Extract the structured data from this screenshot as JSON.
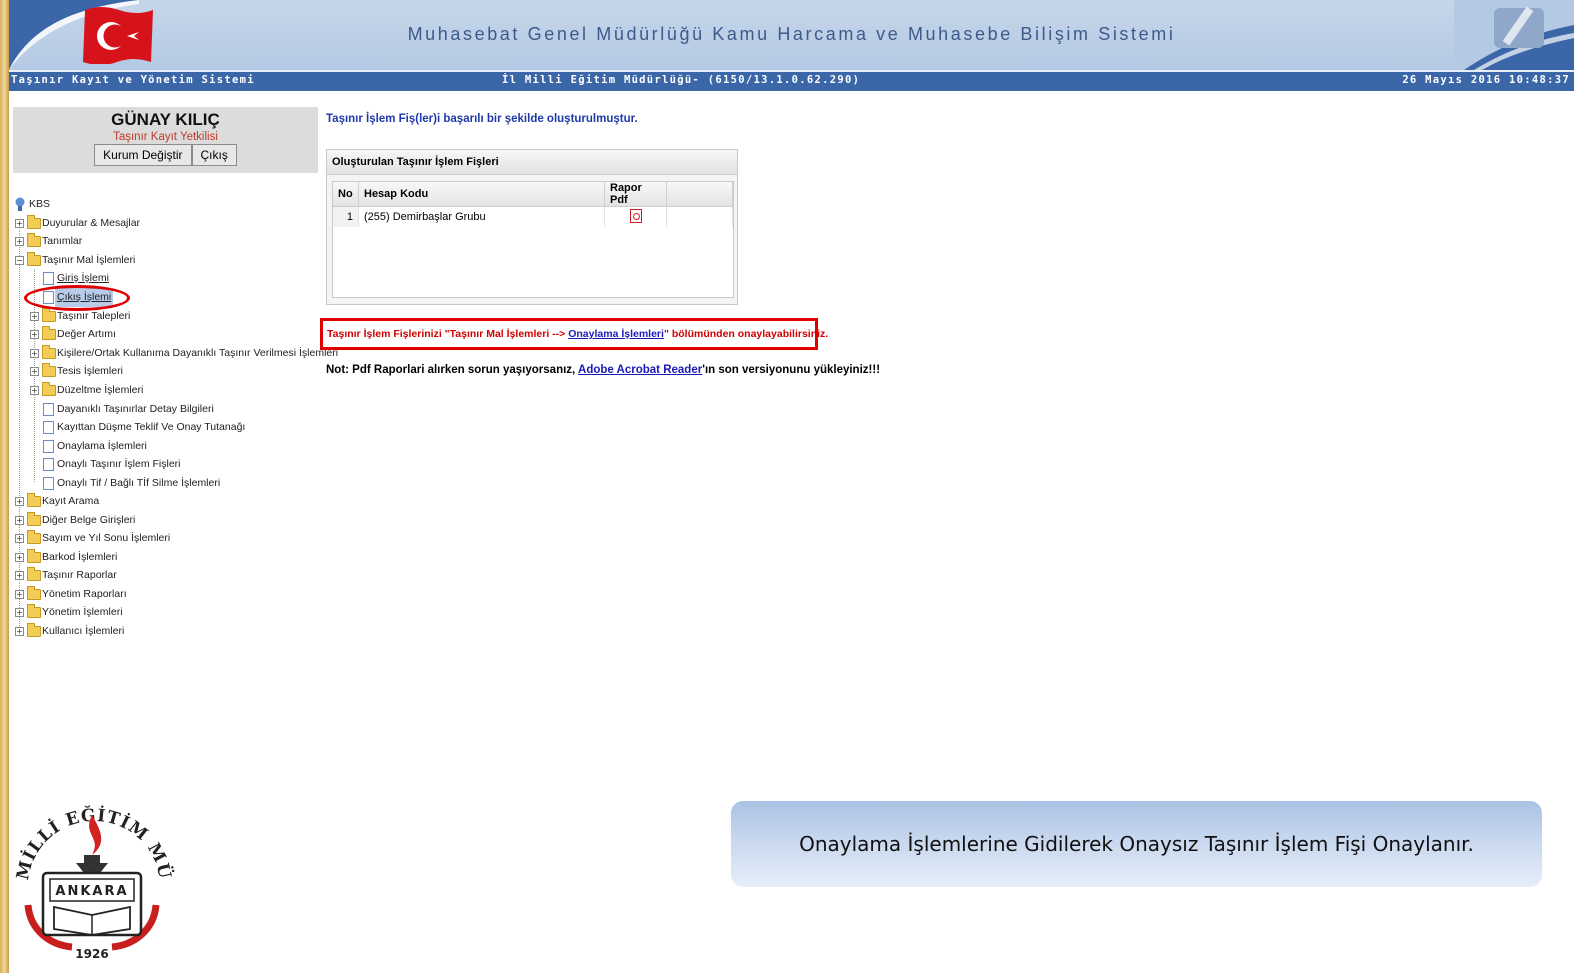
{
  "header": {
    "title": "Muhasebat Genel Müdürlüğü Kamu Harcama ve Muhasebe Bilişim Sistemi",
    "system_name": "Taşınır Kayıt ve Yönetim Sistemi",
    "institution": "İl Milli Eğitim Müdürlüğü- (6150/13.1.0.62.290)",
    "datetime": "26 Mayıs 2016 10:48:37"
  },
  "user": {
    "name": "GÜNAY KILIÇ",
    "role": "Taşınır Kayıt Yetkilisi",
    "change_org_label": "Kurum Değiştir",
    "logout_label": "Çıkış"
  },
  "tree": {
    "root": "KBS",
    "items": [
      {
        "label": "Duyurular & Mesajlar"
      },
      {
        "label": "Tanımlar"
      },
      {
        "label": "Taşınır Mal İşlemleri"
      },
      {
        "label": "Giriş İşlemi"
      },
      {
        "label": "Çıkış İşlemi"
      },
      {
        "label": "Taşınır Talepleri"
      },
      {
        "label": "Değer Artımı"
      },
      {
        "label": "Kişilere/Ortak Kullanıma Dayanıklı Taşınır Verilmesi İşlemleri"
      },
      {
        "label": "Tesis İşlemleri"
      },
      {
        "label": "Düzeltme İşlemleri"
      },
      {
        "label": "Dayanıklı Taşınırlar Detay Bilgileri"
      },
      {
        "label": "Kayıttan Düşme Teklif Ve Onay Tutanağı"
      },
      {
        "label": "Onaylama İşlemleri"
      },
      {
        "label": "Onaylı Taşınır İşlem Fişleri"
      },
      {
        "label": "Onaylı Tif / Bağlı Tİf Silme İşlemleri"
      },
      {
        "label": "Kayıt Arama"
      },
      {
        "label": "Diğer Belge Girişleri"
      },
      {
        "label": "Sayım ve Yıl Sonu İşlemleri"
      },
      {
        "label": "Barkod İşlemleri"
      },
      {
        "label": "Taşınır Raporlar"
      },
      {
        "label": "Yönetim Raporları"
      },
      {
        "label": "Yönetim İşlemleri"
      },
      {
        "label": "Kullanıcı İşlemleri"
      }
    ]
  },
  "main": {
    "success_message": "Taşınır İşlem Fiş(ler)i başarılı bir şekilde oluşturulmuştur.",
    "panel_title": "Oluşturulan Taşınır İşlem Fişleri",
    "table": {
      "headers": [
        "No",
        "Hesap Kodu",
        "Rapor Pdf"
      ],
      "rows": [
        {
          "no": "1",
          "hesap_kodu": "(255) Demirbaşlar Grubu",
          "pdf_icon": "pdf-icon"
        }
      ]
    },
    "notice": {
      "prefix": "Taşınır İşlem Fişlerinizi \"Taşınır Mal İşlemleri --> ",
      "link": "Onaylama İşlemleri",
      "suffix": "\" bölümünden onaylayabilirsiniz."
    },
    "pdf_note": {
      "prefix": "Not: Pdf Raporlari alırken sorun yaşıyorsanız, ",
      "link": "Adobe Acrobat Reader",
      "suffix": "'ın son versiyonunu yükleyiniz!!!"
    }
  },
  "logo": {
    "top_text": "MİLLİ EĞİTİM MÜDÜRLÜĞÜ",
    "city": "ANKARA",
    "year": "1926"
  },
  "callout": {
    "text": "Onaylama İşlemlerine Gidilerek Onaysız Taşınır İşlem Fişi Onaylanır."
  },
  "colors": {
    "header_bg": "#b4c9e3",
    "subbar_bg": "#3b67a8",
    "highlight_red": "#e00000",
    "link_blue": "#1a1ab8"
  }
}
